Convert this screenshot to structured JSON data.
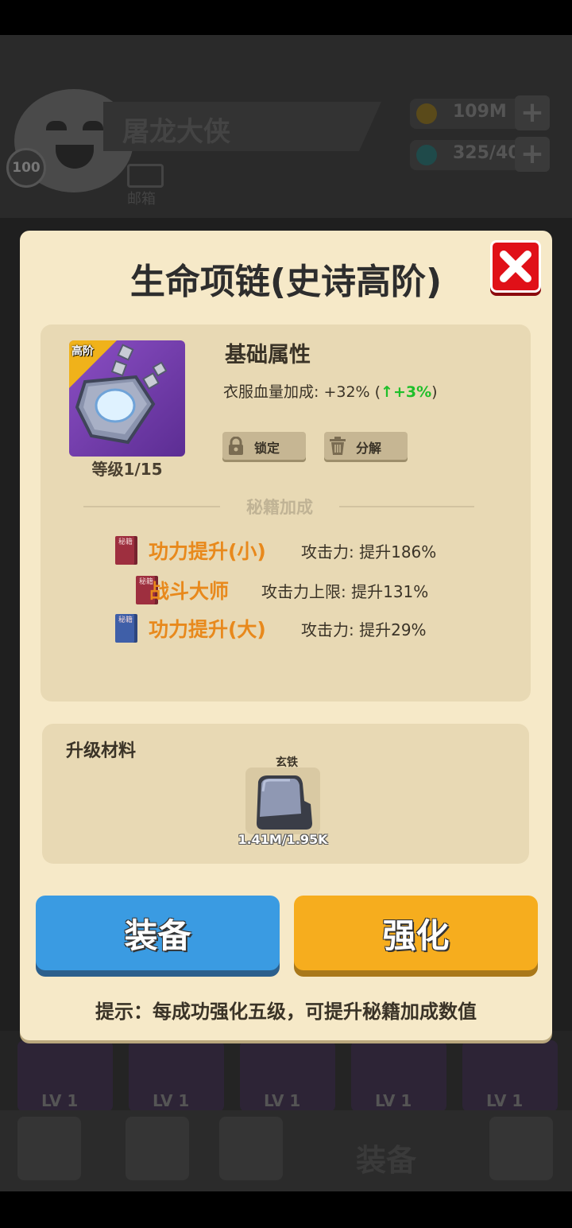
{
  "background": {
    "player_name": "屠龙大侠",
    "player_level": "100",
    "mailbox_label": "邮箱",
    "gold": "109M",
    "gems": "325/40",
    "slot_level": "LV 1",
    "nav_equip_label": "装备"
  },
  "dialog": {
    "title": "生命项链(史诗高阶)",
    "item": {
      "rarity_badge": "高阶",
      "level": "等级1/15"
    },
    "base_attr": {
      "title": "基础属性",
      "text": "衣服血量加成: +32% (",
      "arrow": "↑",
      "bonus": "+3%",
      "close": ")"
    },
    "buttons": {
      "lock": "锁定",
      "decompose": "分解",
      "equip": "装备",
      "enhance": "强化"
    },
    "secret_title": "秘籍加成",
    "book_label": "秘籍",
    "skills": [
      {
        "name": "功力提升(小)",
        "desc": "攻击力: 提升186%",
        "color": "red"
      },
      {
        "name": "战斗大师",
        "desc": "攻击力上限: 提升131%",
        "color": "red"
      },
      {
        "name": "功力提升(大)",
        "desc": "攻击力: 提升29%",
        "color": "blue"
      }
    ],
    "material": {
      "title": "升级材料",
      "name": "玄铁",
      "count": "1.41M/1.95K"
    },
    "hint": "提示：每成功强化五级，可提升秘籍加成数值"
  },
  "colors": {
    "dialog_bg": "#f6e9c8",
    "equip_button": "#3a9be2",
    "enhance_button": "#f6ad1e",
    "close_button": "#e01018",
    "skill_name": "#e8891c",
    "bonus_green": "#1fbf2a"
  },
  "icons": {
    "close": "close-x-icon",
    "lock": "lock-icon",
    "decompose": "trash-icon",
    "item": "necklace-icon",
    "material": "iron-ore-icon"
  }
}
